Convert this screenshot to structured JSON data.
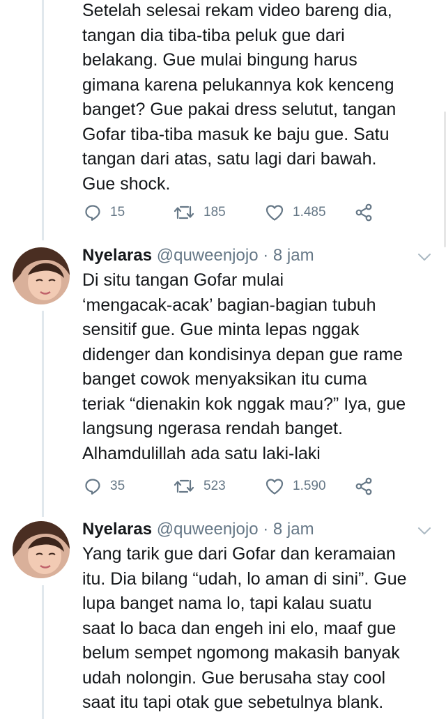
{
  "tweets": [
    {
      "text_lines": [
        "Setelah selesai rekam video bareng dia,",
        "tangan dia tiba-tiba peluk gue dari",
        "belakang. Gue mulai bingung harus",
        "gimana karena pelukannya kok kenceng",
        "banget? Gue pakai dress selutut, tangan",
        "Gofar tiba-tiba masuk ke baju gue. Satu",
        "tangan dari atas, satu lagi dari bawah.",
        "Gue shock."
      ],
      "replies": "15",
      "retweets": "185",
      "likes": "1.485"
    },
    {
      "name": "Nyelaras",
      "handle": "@quweenjojo",
      "separator": "·",
      "time": "8 jam",
      "text_lines": [
        "Di situ tangan Gofar mulai",
        "‘mengacak-acak’ bagian-bagian tubuh",
        "sensitif gue. Gue minta lepas nggak",
        "didenger dan kondisinya depan gue rame",
        "banget cowok menyaksikan itu cuma",
        "teriak “dienakin kok nggak mau?” Iya, gue",
        "langsung ngerasa rendah banget.",
        "Alhamdulillah ada satu laki-laki"
      ],
      "replies": "35",
      "retweets": "523",
      "likes": "1.590"
    },
    {
      "name": "Nyelaras",
      "handle": "@quweenjojo",
      "separator": "·",
      "time": "8 jam",
      "text_lines": [
        "Yang tarik gue dari Gofar dan keramaian",
        "itu. Dia bilang “udah, lo aman di sini”. Gue",
        "lupa banget nama lo, tapi kalau suatu",
        "saat lo baca dan engeh ini elo, maaf gue",
        "belum sempet ngomong makasih banyak",
        "udah nolongin. Gue berusaha stay cool",
        "saat itu tapi otak gue sebetulnya blank."
      ]
    }
  ],
  "icons": {
    "reply": "reply-icon",
    "retweet": "retweet-icon",
    "like": "heart-icon",
    "share": "share-icon",
    "caret": "chevron-down-icon"
  },
  "colors": {
    "text": "#14171a",
    "secondary": "#657786",
    "thread_line": "#e1e8ed"
  }
}
